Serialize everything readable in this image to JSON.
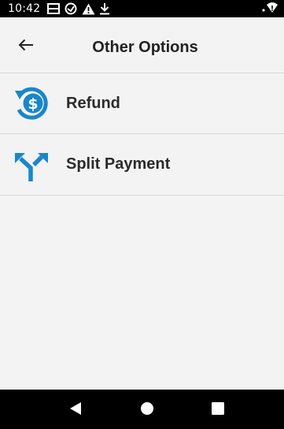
{
  "status_bar": {
    "time": "10:42",
    "icons": [
      "notification-icon",
      "data-saver-icon",
      "warning-icon",
      "download-icon",
      "wifi-icon"
    ]
  },
  "header": {
    "title": "Other Options",
    "back_icon": "arrow-left-icon"
  },
  "options": [
    {
      "label": "Refund",
      "icon": "refund-dollar-icon"
    },
    {
      "label": "Split Payment",
      "icon": "split-arrows-icon"
    }
  ],
  "nav_bar": {
    "buttons": [
      "back-triangle-icon",
      "home-circle-icon",
      "recents-square-icon"
    ]
  },
  "colors": {
    "accent": "#1a86c9",
    "background": "#f3f3f3",
    "divider": "#d7d7d7",
    "text": "#2b2b2b",
    "bar": "#000000"
  }
}
